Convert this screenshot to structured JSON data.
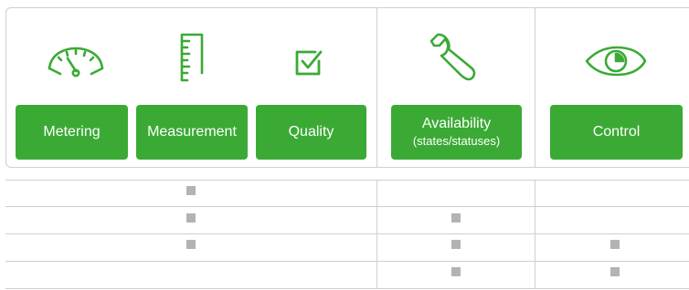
{
  "categories": [
    {
      "icon": "speedometer-icon",
      "label": "Metering",
      "sub": ""
    },
    {
      "icon": "ruler-icon",
      "label": "Measurement",
      "sub": ""
    },
    {
      "icon": "checkbox-icon",
      "label": "Quality",
      "sub": ""
    },
    {
      "icon": "wrench-icon",
      "label": "Availability",
      "sub": "(states/statuses)"
    },
    {
      "icon": "eye-icon",
      "label": "Control",
      "sub": ""
    }
  ],
  "matrix": {
    "columns": [
      "measurement",
      "availability",
      "control"
    ],
    "rows": [
      {
        "measurement": true,
        "availability": false,
        "control": false
      },
      {
        "measurement": true,
        "availability": true,
        "control": false
      },
      {
        "measurement": true,
        "availability": true,
        "control": true
      },
      {
        "measurement": false,
        "availability": true,
        "control": true
      }
    ]
  },
  "colors": {
    "accent": "#3aaa35",
    "marker": "#b3b3b3",
    "border": "#cfcfcf"
  }
}
